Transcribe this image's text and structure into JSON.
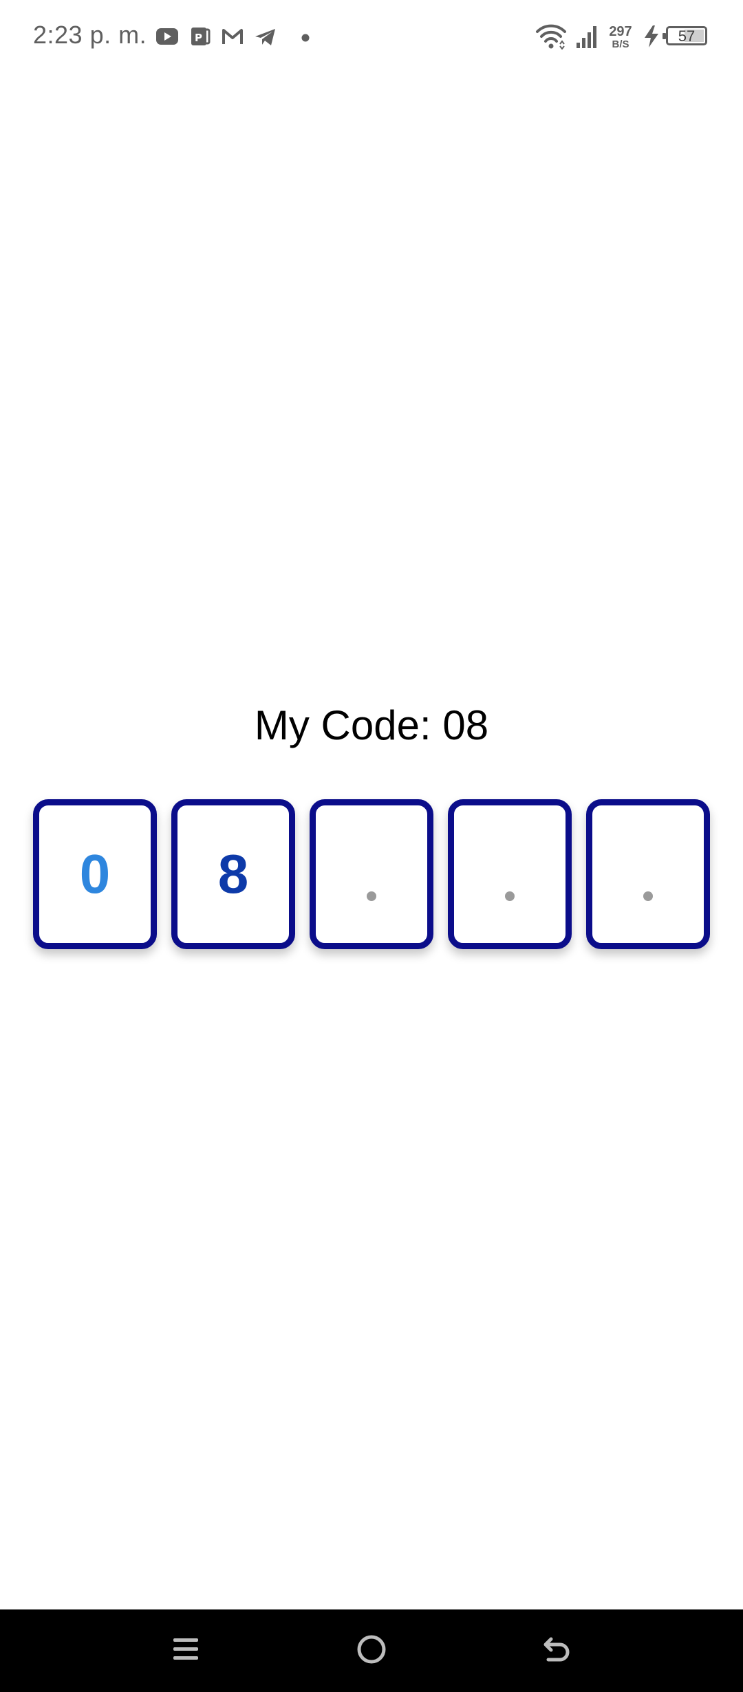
{
  "status_bar": {
    "time": "2:23 p. m.",
    "notification_icons": [
      "youtube-icon",
      "pdf-app-icon",
      "gmail-icon",
      "telegram-icon",
      "more-dot-icon"
    ],
    "net_speed_value": "297",
    "net_speed_unit": "B/S",
    "battery_level": "57",
    "battery_fraction": 0.57
  },
  "main": {
    "title_label": "My Code:",
    "title_value": "08",
    "code_slots": [
      {
        "value": "0",
        "state": "filled",
        "color": "#2e86de"
      },
      {
        "value": "8",
        "state": "filled",
        "color": "#0d3aa9"
      },
      {
        "value": "",
        "state": "empty"
      },
      {
        "value": "",
        "state": "empty"
      },
      {
        "value": "",
        "state": "empty"
      }
    ],
    "box_border_color": "#0b0d8a",
    "empty_dot_color": "#9a9a9a"
  },
  "nav_bar": {
    "buttons": [
      "menu-icon",
      "home-icon",
      "back-icon"
    ]
  }
}
